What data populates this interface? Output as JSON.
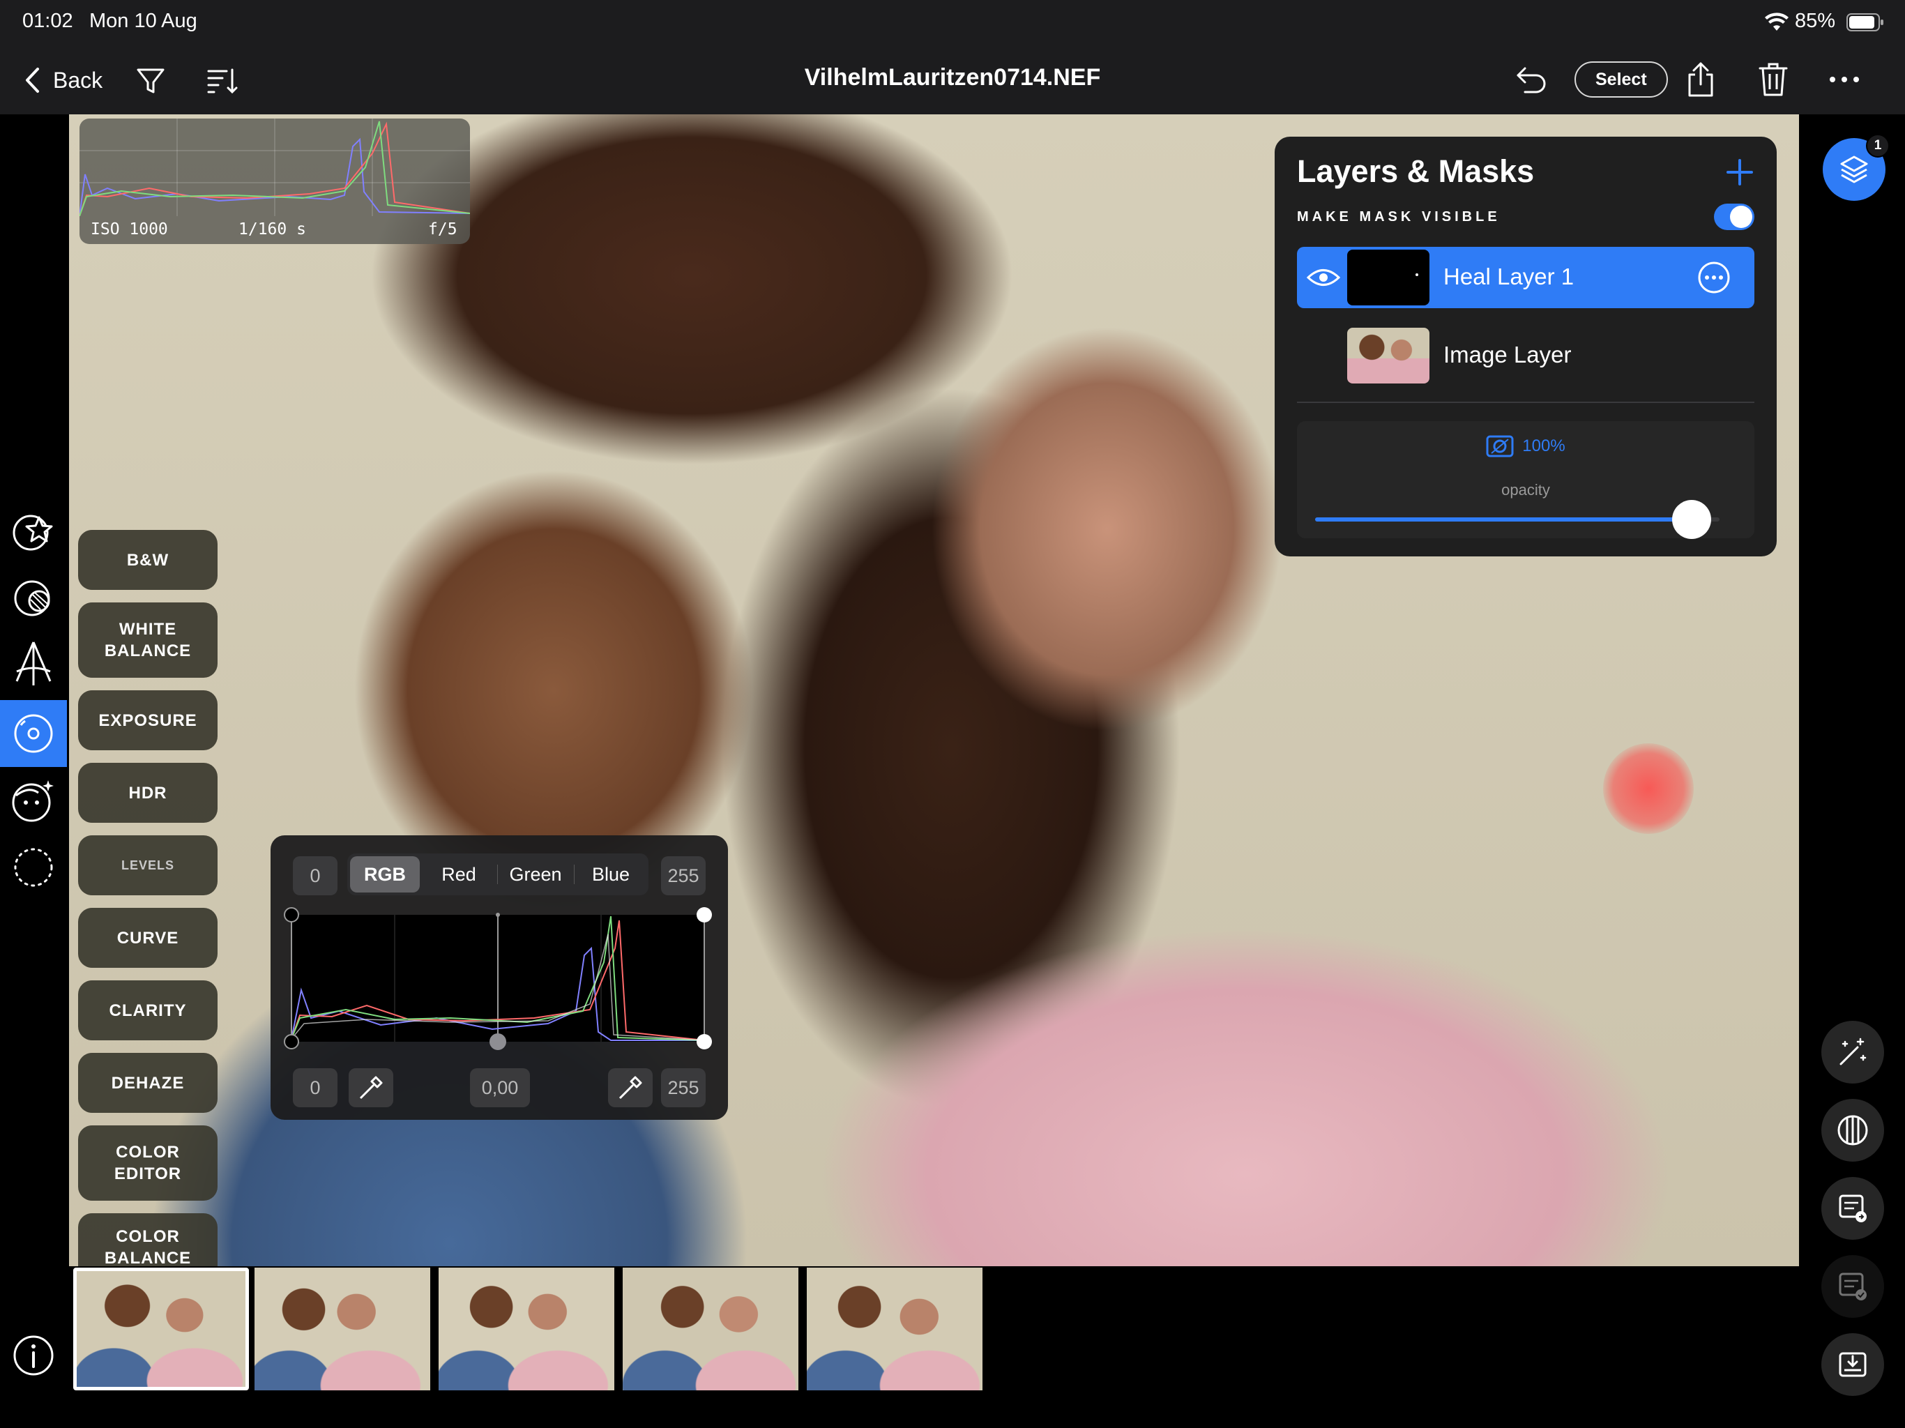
{
  "status_bar": {
    "time": "01:02",
    "date": "Mon 10 Aug",
    "battery": "85%"
  },
  "nav": {
    "back_label": "Back",
    "title": "VilhelmLauritzen0714.NEF",
    "select_label": "Select"
  },
  "histogram": {
    "iso": "ISO 1000",
    "shutter": "1/160 s",
    "aperture": "f/5"
  },
  "left_rail": [
    "favorite-star-icon",
    "tone-icon",
    "perspective-icon",
    "adjust-icon",
    "portrait-icon",
    "select-lasso-icon",
    "info-icon"
  ],
  "adjustments": [
    "B&W",
    "WHITE\nBALANCE",
    "EXPOSURE",
    "HDR",
    "LEVELS",
    "CURVE",
    "CLARITY",
    "DEHAZE",
    "COLOR\nEDITOR",
    "COLOR\nBALANCE"
  ],
  "levels": {
    "black_input": "0",
    "white_input": "255",
    "tabs": [
      "RGB",
      "Red",
      "Green",
      "Blue"
    ],
    "selected_tab": "RGB",
    "black_output": "0",
    "midtone": "0,00",
    "white_output": "255"
  },
  "layers": {
    "title": "Layers & Masks",
    "mask_visible_label": "MAKE MASK VISIBLE",
    "mask_visible": true,
    "items": [
      {
        "name": "Heal Layer 1",
        "active": true
      },
      {
        "name": "Image Layer",
        "active": false
      }
    ],
    "opacity_value": "100%",
    "opacity_label": "opacity",
    "opacity_fraction": 1.0
  },
  "right_rail": {
    "layers_badge": "1"
  },
  "colors": {
    "accent": "#2f7cf6",
    "panel": "#1f1f1f",
    "button": "#3a382e"
  }
}
